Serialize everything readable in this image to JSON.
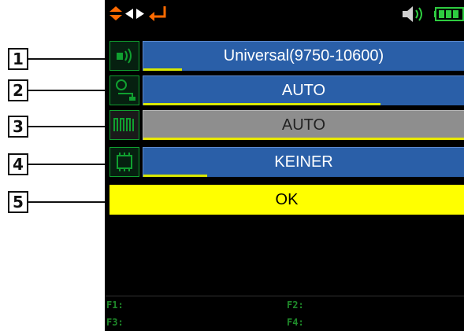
{
  "callouts": [
    "1",
    "2",
    "3",
    "4",
    "5"
  ],
  "rows": [
    {
      "value": "Universal(9750-10600)",
      "progress": 0.12,
      "icon": "antenna-signal-icon"
    },
    {
      "value": "AUTO",
      "progress": 0.74,
      "icon": "power-supply-icon"
    },
    {
      "value": "AUTO",
      "progress": 0.0,
      "icon": "filter-comb-icon"
    },
    {
      "value": "KEINER",
      "progress": 0.2,
      "icon": "switch-box-icon"
    }
  ],
  "ok_button": {
    "label": "OK"
  },
  "footer": {
    "f1": "F1:",
    "f2": "F2:",
    "f3": "F3:",
    "f4": "F4:"
  },
  "colors": {
    "accent_orange": "#ff6a00",
    "icon_green": "#10a030",
    "bar_blue": "#2a5fa8",
    "ok_yellow": "#ffff00"
  }
}
